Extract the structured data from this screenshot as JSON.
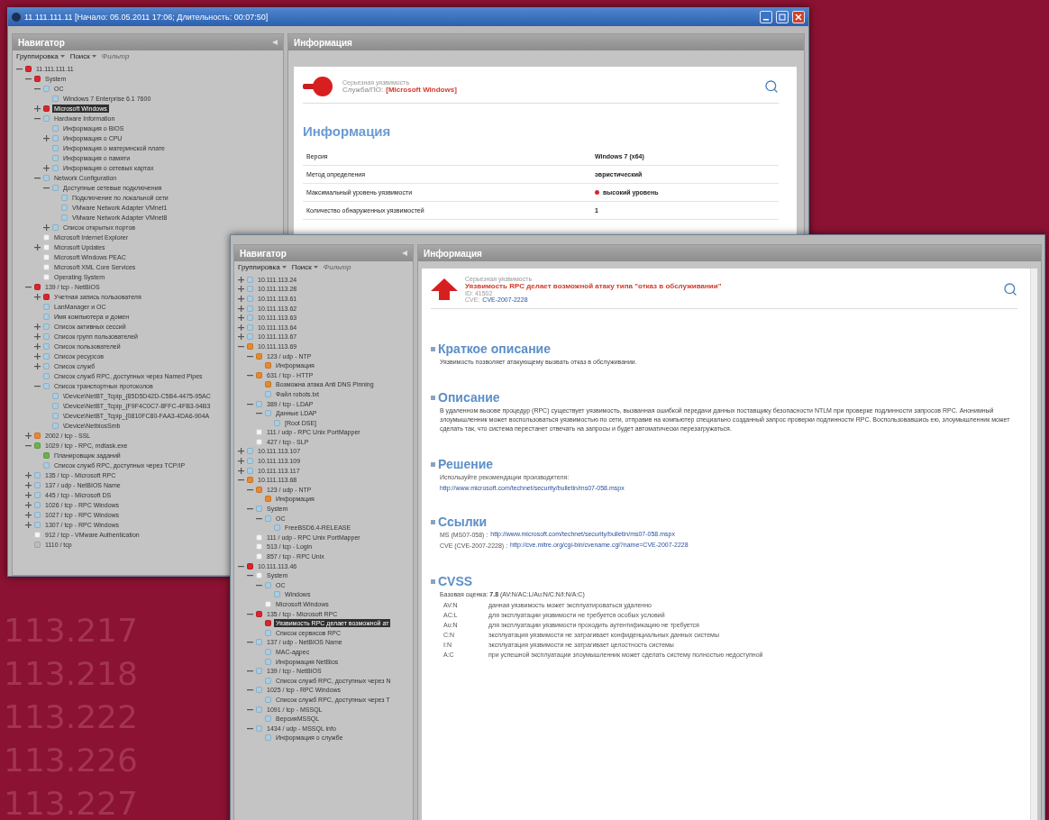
{
  "background_labels": [
    "113.217",
    "113.218",
    "113.222",
    "113.226",
    "113.227"
  ],
  "back_window": {
    "title": "11.111.111.11 [Начало: 05.05.2011 17:06; Длительность: 00:07:50]",
    "navigator": {
      "title": "Навигатор",
      "toolbar": [
        {
          "label": "Группировка",
          "disabled": false
        },
        {
          "label": "Поиск",
          "disabled": false
        },
        {
          "label": "Фильтр",
          "disabled": true
        }
      ],
      "tree": [
        {
          "label": "11.111.111.11",
          "color": "#d8262c",
          "expanded": true,
          "selected": false,
          "children": [
            {
              "label": "System",
              "color": "#d8262c",
              "expanded": true,
              "selected": false,
              "children": [
                {
                  "label": "ОС",
                  "color": "#a9cde3",
                  "expanded": true,
                  "selected": false,
                  "children": [
                    {
                      "label": "Windows 7 Enterprise 6.1 7600",
                      "color": "#a9cde3",
                      "selected": false
                    }
                  ]
                },
                {
                  "label": "Microsoft Windows",
                  "color": "#d8262c",
                  "expanded": false,
                  "selected": true
                },
                {
                  "label": "Hardware Information",
                  "color": "#a9cde3",
                  "expanded": true,
                  "selected": false,
                  "children": [
                    {
                      "label": "Информация о BIOS",
                      "color": "#a9cde3",
                      "selected": false
                    },
                    {
                      "label": "Информация о CPU",
                      "color": "#a9cde3",
                      "expanded": false,
                      "selected": false
                    },
                    {
                      "label": "Информация о материнской плате",
                      "color": "#a9cde3",
                      "selected": false
                    },
                    {
                      "label": "Информация о памяти",
                      "color": "#a9cde3",
                      "selected": false
                    },
                    {
                      "label": "Информация о сетевых картах",
                      "color": "#a9cde3",
                      "expanded": false,
                      "selected": false
                    }
                  ]
                },
                {
                  "label": "Network Configuration",
                  "color": "#a9cde3",
                  "expanded": true,
                  "selected": false,
                  "children": [
                    {
                      "label": "Доступные сетевые подключения",
                      "color": "#a9cde3",
                      "expanded": true,
                      "selected": false,
                      "children": [
                        {
                          "label": "Подключение по локальной сети",
                          "color": "#a9cde3",
                          "selected": false
                        },
                        {
                          "label": "VMware Network Adapter VMnet1",
                          "color": "#a9cde3",
                          "selected": false
                        },
                        {
                          "label": "VMware Network Adapter VMnet8",
                          "color": "#a9cde3",
                          "selected": false
                        }
                      ]
                    },
                    {
                      "label": "Список открытых портов",
                      "color": "#a9cde3",
                      "expanded": false,
                      "selected": false
                    }
                  ]
                },
                {
                  "label": "Microsoft Internet Explorer",
                  "color": "#f4f4f4",
                  "selected": false
                },
                {
                  "label": "Microsoft Updates",
                  "color": "#f4f4f4",
                  "expanded": false,
                  "selected": false
                },
                {
                  "label": "Microsoft Windows PEAC",
                  "color": "#f4f4f4",
                  "selected": false
                },
                {
                  "label": "Microsoft XML Core Services",
                  "color": "#f4f4f4",
                  "selected": false
                },
                {
                  "label": "Operating System",
                  "color": "#f4f4f4",
                  "selected": false
                }
              ]
            },
            {
              "label": "139 / tcp - NetBIOS",
              "color": "#d8262c",
              "expanded": true,
              "selected": false,
              "children": [
                {
                  "label": "Учетная запись пользователя",
                  "color": "#d8262c",
                  "expanded": false,
                  "selected": false
                },
                {
                  "label": "LanManager и ОС",
                  "color": "#a9cde3",
                  "selected": false
                },
                {
                  "label": "Имя компьютера и домен",
                  "color": "#a9cde3",
                  "selected": false
                },
                {
                  "label": "Список активных сессий",
                  "color": "#a9cde3",
                  "expanded": false,
                  "selected": false
                },
                {
                  "label": "Список групп пользователей",
                  "color": "#a9cde3",
                  "expanded": false,
                  "selected": false
                },
                {
                  "label": "Список пользователей",
                  "color": "#a9cde3",
                  "expanded": false,
                  "selected": false
                },
                {
                  "label": "Список ресурсов",
                  "color": "#a9cde3",
                  "expanded": false,
                  "selected": false
                },
                {
                  "label": "Список служб",
                  "color": "#a9cde3",
                  "expanded": false,
                  "selected": false
                },
                {
                  "label": "Список служб RPC, доступных через Named Pipes",
                  "color": "#a9cde3",
                  "selected": false
                },
                {
                  "label": "Список транспортных протоколов",
                  "color": "#a9cde3",
                  "expanded": true,
                  "selected": false,
                  "children": [
                    {
                      "label": "\\Device\\NetBT_Tcpip_{85D5D42D-C5B4-4475-95AC",
                      "color": "#a9cde3",
                      "selected": false
                    },
                    {
                      "label": "\\Device\\NetBT_Tcpip_{F9F4C0C7-8FFC-4FB3-94B3",
                      "color": "#a9cde3",
                      "selected": false
                    },
                    {
                      "label": "\\Device\\NetBT_Tcpip_{0810FC80-FAA3-4DA6-904A",
                      "color": "#a9cde3",
                      "selected": false
                    },
                    {
                      "label": "\\Device\\NetbiosSmb",
                      "color": "#a9cde3",
                      "selected": false
                    }
                  ]
                }
              ]
            },
            {
              "label": "2002 / tcp - SSL",
              "color": "#e8892c",
              "expanded": false,
              "selected": false
            },
            {
              "label": "1029 / tcp - RPC, mdtask.exe",
              "color": "#6bb34a",
              "expanded": true,
              "selected": false,
              "children": [
                {
                  "label": "Планировщик заданий",
                  "color": "#6bb34a",
                  "selected": false
                },
                {
                  "label": "Список служб RPC, доступных через TCP/IP",
                  "color": "#a9cde3",
                  "selected": false
                }
              ]
            },
            {
              "label": "135 / tcp - Microsoft RPC",
              "color": "#a9cde3",
              "expanded": false,
              "selected": false
            },
            {
              "label": "137 / udp - NetBIOS Name",
              "color": "#a9cde3",
              "expanded": false,
              "selected": false
            },
            {
              "label": "445 / tcp - Microsoft DS",
              "color": "#a9cde3",
              "expanded": false,
              "selected": false
            },
            {
              "label": "1026 / tcp - RPC Windows",
              "color": "#a9cde3",
              "expanded": false,
              "selected": false
            },
            {
              "label": "1027 / tcp - RPC Windows",
              "color": "#a9cde3",
              "expanded": false,
              "selected": false
            },
            {
              "label": "1307 / tcp - RPC Windows",
              "color": "#a9cde3",
              "expanded": false,
              "selected": false
            },
            {
              "label": "912 / tcp - VMware Authentication",
              "color": "#f4f4f4",
              "selected": false
            },
            {
              "label": "1110 / tcp",
              "color": "#bdbdbd",
              "selected": false
            }
          ]
        }
      ]
    },
    "info": {
      "title": "Информация",
      "severity": "Серьезная уязвимость",
      "service_label": "Служба/ПО:",
      "service_value": "[Microsoft Windows]",
      "heading": "Информация",
      "rows": [
        {
          "label": "Версия",
          "value": "Windows 7 (x64)",
          "kind": "text"
        },
        {
          "label": "Метод определения",
          "value": "эвристический",
          "kind": "text"
        },
        {
          "label": "Максимальный уровень уязвимости",
          "value": "высокий уровень",
          "kind": "level",
          "color": "#d8262c"
        },
        {
          "label": "Количество обнаруженных уязвимостей",
          "value": "1",
          "kind": "text"
        }
      ]
    }
  },
  "front_window": {
    "navigator": {
      "title": "Навигатор",
      "toolbar": [
        {
          "label": "Группировка",
          "disabled": false
        },
        {
          "label": "Поиск",
          "disabled": false
        },
        {
          "label": "Фильтр",
          "disabled": true
        }
      ],
      "tree": [
        {
          "label": "10.111.113.24",
          "color": "#a9cde3",
          "expanded": false,
          "selected": false
        },
        {
          "label": "10.111.113.28",
          "color": "#a9cde3",
          "expanded": false,
          "selected": false
        },
        {
          "label": "10.111.113.61",
          "color": "#a9cde3",
          "expanded": false,
          "selected": false
        },
        {
          "label": "10.111.113.62",
          "color": "#a9cde3",
          "expanded": false,
          "selected": false
        },
        {
          "label": "10.111.113.63",
          "color": "#a9cde3",
          "expanded": false,
          "selected": false
        },
        {
          "label": "10.111.113.64",
          "color": "#a9cde3",
          "expanded": false,
          "selected": false
        },
        {
          "label": "10.111.113.67",
          "color": "#a9cde3",
          "expanded": false,
          "selected": false
        },
        {
          "label": "10.111.113.69",
          "color": "#e8892c",
          "expanded": true,
          "selected": false,
          "children": [
            {
              "label": "123 / udp - NTP",
              "color": "#e8892c",
              "expanded": true,
              "selected": false,
              "children": [
                {
                  "label": "Информация",
                  "color": "#e8892c",
                  "selected": false
                }
              ]
            },
            {
              "label": "631 / tcp - HTTP",
              "color": "#e8892c",
              "expanded": true,
              "selected": false,
              "children": [
                {
                  "label": "Возможна атака Anti DNS Pinning",
                  "color": "#e8892c",
                  "selected": false
                },
                {
                  "label": "Файл robots.txt",
                  "color": "#a9cde3",
                  "selected": false
                }
              ]
            },
            {
              "label": "389 / tcp - LDAP",
              "color": "#a9cde3",
              "expanded": true,
              "selected": false,
              "children": [
                {
                  "label": "Данные LDAP",
                  "color": "#a9cde3",
                  "expanded": true,
                  "selected": false,
                  "children": [
                    {
                      "label": "[Root DSE]",
                      "color": "#a9cde3",
                      "selected": false
                    }
                  ]
                }
              ]
            },
            {
              "label": "111 / udp - RPC Unix PortMapper",
              "color": "#f4f4f4",
              "selected": false
            },
            {
              "label": "427 / tcp - SLP",
              "color": "#f4f4f4",
              "selected": false
            }
          ]
        },
        {
          "label": "10.111.113.107",
          "color": "#a9cde3",
          "expanded": false,
          "selected": false
        },
        {
          "label": "10.111.113.109",
          "color": "#a9cde3",
          "expanded": false,
          "selected": false
        },
        {
          "label": "10.111.113.117",
          "color": "#a9cde3",
          "expanded": false,
          "selected": false
        },
        {
          "label": "10.111.113.68",
          "color": "#e8892c",
          "expanded": true,
          "selected": false,
          "children": [
            {
              "label": "123 / udp - NTP",
              "color": "#e8892c",
              "expanded": true,
              "selected": false,
              "children": [
                {
                  "label": "Информация",
                  "color": "#e8892c",
                  "selected": false
                }
              ]
            },
            {
              "label": "System",
              "color": "#a9cde3",
              "expanded": true,
              "selected": false,
              "children": [
                {
                  "label": "ОС",
                  "color": "#a9cde3",
                  "expanded": true,
                  "selected": false,
                  "children": [
                    {
                      "label": "FreeBSD6.4-RELEASE",
                      "color": "#a9cde3",
                      "selected": false
                    }
                  ]
                }
              ]
            },
            {
              "label": "111 / udp - RPC Unix PortMapper",
              "color": "#f4f4f4",
              "selected": false
            },
            {
              "label": "513 / tcp - Login",
              "color": "#f4f4f4",
              "selected": false
            },
            {
              "label": "857 / tcp - RPC Unix",
              "color": "#f4f4f4",
              "selected": false
            }
          ]
        },
        {
          "label": "10.111.113.46",
          "color": "#d8262c",
          "expanded": true,
          "selected": false,
          "children": [
            {
              "label": "System",
              "color": "#f4f4f4",
              "expanded": true,
              "selected": false,
              "children": [
                {
                  "label": "ОС",
                  "color": "#a9cde3",
                  "expanded": true,
                  "selected": false,
                  "children": [
                    {
                      "label": "Windows",
                      "color": "#a9cde3",
                      "selected": false
                    }
                  ]
                },
                {
                  "label": "Microsoft Windows",
                  "color": "#f4f4f4",
                  "selected": false
                }
              ]
            },
            {
              "label": "135 / tcp - Microsoft RPC",
              "color": "#d8262c",
              "expanded": true,
              "selected": false,
              "children": [
                {
                  "label": "Уязвимость RPC делает возможной ат",
                  "color": "#d8262c",
                  "selected": true
                },
                {
                  "label": "Список сервисов RPC",
                  "color": "#a9cde3",
                  "selected": false
                }
              ]
            },
            {
              "label": "137 / udp - NetBIOS Name",
              "color": "#a9cde3",
              "expanded": true,
              "selected": false,
              "children": [
                {
                  "label": "MAC-адрес",
                  "color": "#a9cde3",
                  "selected": false
                },
                {
                  "label": "Информация NetBios",
                  "color": "#a9cde3",
                  "selected": false
                }
              ]
            },
            {
              "label": "139 / tcp - NetBIOS",
              "color": "#a9cde3",
              "expanded": true,
              "selected": false,
              "children": [
                {
                  "label": "Список служб RPC, доступных через N",
                  "color": "#a9cde3",
                  "selected": false
                }
              ]
            },
            {
              "label": "1025 / tcp - RPC Windows",
              "color": "#a9cde3",
              "expanded": true,
              "selected": false,
              "children": [
                {
                  "label": "Список служб RPC, доступных через T",
                  "color": "#a9cde3",
                  "selected": false
                }
              ]
            },
            {
              "label": "1091 / tcp - MSSQL",
              "color": "#a9cde3",
              "expanded": true,
              "selected": false,
              "children": [
                {
                  "label": "ВерсияMSSQL",
                  "color": "#a9cde3",
                  "selected": false
                }
              ]
            },
            {
              "label": "1434 / udp - MSSQL info",
              "color": "#a9cde3",
              "expanded": true,
              "selected": false,
              "children": [
                {
                  "label": "Информация о службе",
                  "color": "#a9cde3",
                  "selected": false
                }
              ]
            }
          ]
        }
      ]
    },
    "info": {
      "title": "Информация",
      "severity": "Серьезная уязвимость",
      "vuln_title": "Уязвимость RPC делает возможной атаку типа \"отказ в обслуживании\"",
      "id": "ID: 41502",
      "cve_label": "CVE:",
      "cve_link": "CVE-2007-2228",
      "sections": [
        {
          "kind": "text",
          "heading": "Краткое описание",
          "lines": [
            "Уязвимость позволяет атакующему вызвать отказ в обслуживании."
          ]
        },
        {
          "kind": "text",
          "heading": "Описание",
          "lines": [
            "В удаленном вызове процедур (RPC) существует уязвимость, вызванная ошибкой передачи данных поставщику безопасности NTLM при проверке подлинности запросов RPC. Анонимный злоумышленник может воспользоваться уязвимостью по сети, отправив на компьютер специально созданный запрос проверки подлинности RPC. Воспользовавшись ею, злоумышленник может сделать так, что система перестанет отвечать на запросы и будет автоматически перезагружаться."
          ]
        },
        {
          "kind": "links",
          "heading": "Решение",
          "items": [
            {
              "label": "Используйте рекомендации производителя:",
              "url": "http://www.microsoft.com/technet/security/bulletin/ms07-058.mspx",
              "inline": false
            }
          ]
        },
        {
          "kind": "links",
          "heading": "Ссылки",
          "items": [
            {
              "label": "MS (MS07-058) :",
              "url": "http://www.microsoft.com/technet/security/bulletin/ms07-058.mspx",
              "inline": true
            },
            {
              "label": "CVE (CVE-2007-2228) :",
              "url": "http://cve.mitre.org/cgi-bin/cvename.cgi?name=CVE-2007-2228",
              "inline": true
            }
          ]
        },
        {
          "kind": "cvss",
          "heading": "CVSS",
          "score": "Базовая оценка: **7.8** (AV:N/AC:L/Au:N/C:N/I:N/A:C)",
          "rows": [
            {
              "code": "AV:N",
              "text": "данная уязвимость может эксплуатироваться удаленно"
            },
            {
              "code": "AC:L",
              "text": "для эксплуатации уязвимости не требуется особых условий"
            },
            {
              "code": "Au:N",
              "text": "для эксплуатации уязвимости проходить аутентификацию не требуется"
            },
            {
              "code": "C:N",
              "text": "эксплуатация уязвимости не затрагивает конфиденциальных данных системы"
            },
            {
              "code": "I:N",
              "text": "эксплуатация уязвимости не затрагивает целостность системы"
            },
            {
              "code": "A:C",
              "text": "при успешной эксплуатации злоумышленник может сделать систему полностью недоступной"
            }
          ]
        }
      ]
    }
  }
}
